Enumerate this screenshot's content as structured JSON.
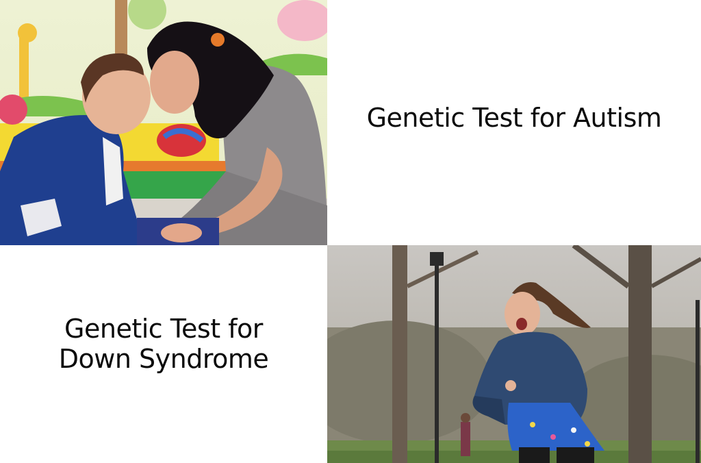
{
  "panels": {
    "autism": {
      "caption": "Genetic Test for Autism",
      "photo": "mother-and-boy-foreheads-touching-photo"
    },
    "down_syndrome": {
      "caption": "Genetic Test for\nDown Syndrome",
      "photo": "girl-running-in-park-photo"
    }
  },
  "colors": {
    "background": "#ffffff",
    "text": "#0a0a0a"
  }
}
